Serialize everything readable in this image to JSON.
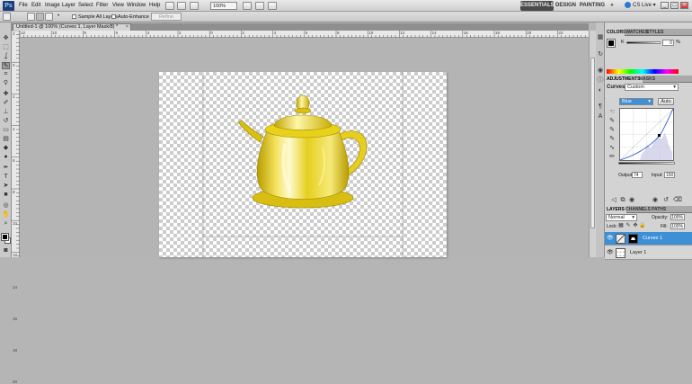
{
  "app": {
    "logo": "Ps"
  },
  "menu": [
    "File",
    "Edit",
    "Image",
    "Layer",
    "Select",
    "Filter",
    "View",
    "Window",
    "Help"
  ],
  "menubar": {
    "zoom": "100%",
    "workspaces": {
      "essentials": "ESSENTIALS",
      "design": "DESIGN",
      "painting": "PAINTING",
      "more": "»"
    },
    "cslive": "CS Live ▾"
  },
  "options": {
    "sample_all_layers": "Sample All Layers",
    "auto_enhance": "Auto-Enhance",
    "refine_edge": "Refine Edge..."
  },
  "document": {
    "tab_title": "Untitled-1 @ 100% (Curves 1, Layer Mask/8) *",
    "close": "×"
  },
  "rulers": {
    "top": [
      "12",
      "10",
      "8",
      "6",
      "4",
      "2",
      "0",
      "2",
      "4",
      "6",
      "8",
      "10",
      "12",
      "14",
      "16",
      "18",
      "20",
      "22"
    ],
    "left": [
      "2",
      "0",
      "2",
      "4",
      "6",
      "8",
      "10",
      "12",
      "14",
      "16",
      "18",
      "20"
    ]
  },
  "colorPanel": {
    "tabs": [
      "COLOR",
      "SWATCHES",
      "STYLES"
    ],
    "k_label": "K",
    "k_value": "0",
    "k_unit": "%"
  },
  "adjustments": {
    "tabs": [
      "ADJUSTMENTS",
      "MASKS"
    ],
    "title": "Curves",
    "preset": "Custom",
    "channel": "Blue",
    "auto_label": "Auto",
    "output_label": "Output:",
    "output_value": "74",
    "input_label": "Input:",
    "input_value": "150"
  },
  "layersPanel": {
    "tabs": [
      "LAYERS",
      "CHANNELS",
      "PATHS"
    ],
    "blend_mode": "Normal",
    "opacity_label": "Opacity:",
    "opacity_value": "100%",
    "lock_label": "Lock:",
    "fill_label": "Fill:",
    "fill_value": "100%",
    "layers": [
      {
        "name": "Curves 1",
        "selected": true
      },
      {
        "name": "Layer 1",
        "selected": false
      }
    ]
  },
  "colors": {
    "selection": "#3d8fd6",
    "accent": "#e8d11a"
  }
}
